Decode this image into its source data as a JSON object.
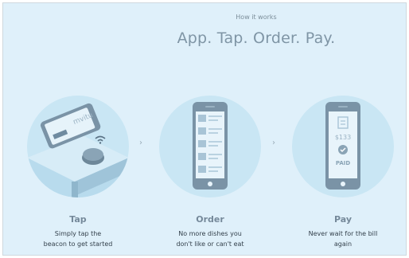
{
  "header": {
    "eyebrow": "How it works",
    "headline": "App. Tap. Order. Pay."
  },
  "steps": [
    {
      "title": "Tap",
      "desc_line1": "Simply tap the",
      "desc_line2": "beacon to get started",
      "icon": "phone-tap-beacon-icon",
      "screen_brand": "mvitu"
    },
    {
      "title": "Order",
      "desc_line1": "No more dishes you",
      "desc_line2": "don't like or can't eat",
      "icon": "phone-menu-icon"
    },
    {
      "title": "Pay",
      "desc_line1": "Never wait for the bill",
      "desc_line2": "again",
      "icon": "phone-payment-icon",
      "amount": "$133",
      "status": "PAID"
    }
  ],
  "separators": [
    "›",
    "›"
  ],
  "colors": {
    "background": "#dff0fa",
    "circle": "#c9e6f4",
    "accent": "#a7c8dc",
    "text_dark": "#34414c"
  }
}
